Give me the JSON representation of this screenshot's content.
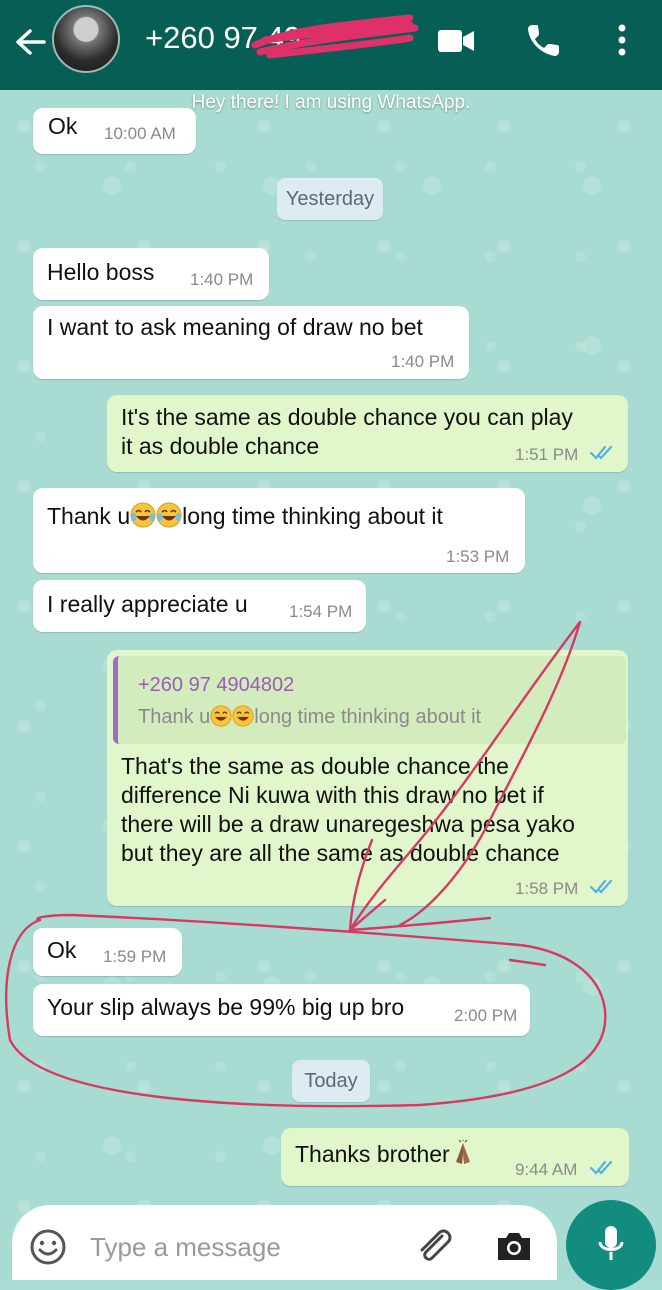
{
  "header": {
    "contact_name": "+260 97 49",
    "status": "Hey there! I am using WhatsApp."
  },
  "icons": {
    "back": "back-arrow-icon",
    "video": "video-call-icon",
    "call": "phone-icon",
    "menu": "more-vert-icon",
    "emoji": "emoji-icon",
    "attach": "paperclip-icon",
    "camera": "camera-icon",
    "mic": "microphone-icon"
  },
  "colors": {
    "header": "#075e54",
    "incoming_bubble": "#ffffff",
    "outgoing_bubble": "#e1f7cb",
    "read_ticks": "#4fb3e6",
    "mic_button": "#128c7e",
    "annotation": "#d63a63"
  },
  "messages": [
    {
      "id": "m0",
      "direction": "in",
      "text": "Ok",
      "time": "10:00 AM"
    },
    {
      "id": "m1",
      "direction": "in",
      "text": "Hello boss",
      "time": "1:40 PM"
    },
    {
      "id": "m2",
      "direction": "in",
      "text": "I want to ask meaning of draw no bet",
      "time": "1:40 PM"
    },
    {
      "id": "m3",
      "direction": "out",
      "line1": "It's the same as double chance you can play",
      "line2": "it as double chance",
      "time": "1:51 PM",
      "read": true
    },
    {
      "id": "m4",
      "direction": "in",
      "text_before": "Thank u",
      "text_after": "long time thinking about it",
      "time": "1:53 PM"
    },
    {
      "id": "m5",
      "direction": "in",
      "text": "I really appreciate u",
      "time": "1:54 PM"
    },
    {
      "id": "m6",
      "direction": "out",
      "quote_author": "+260 97 4904802",
      "quote_before": "Thank u",
      "quote_after": "long time thinking about it",
      "line1": "That's the same as double chance the",
      "line2": "difference Ni kuwa with this draw no bet if",
      "line3": "there will be a draw unaregeshwa pesa yako",
      "line4": "but they are all the same as double chance",
      "time": "1:58 PM",
      "read": true
    },
    {
      "id": "m7",
      "direction": "in",
      "text": "Ok",
      "time": "1:59 PM"
    },
    {
      "id": "m8",
      "direction": "in",
      "text": "Your slip always be 99% big up bro",
      "time": "2:00 PM"
    },
    {
      "id": "m9",
      "direction": "out",
      "text": "Thanks brother",
      "time": "9:44 AM",
      "read": true
    }
  ],
  "date_separators": {
    "yesterday": "Yesterday",
    "today": "Today"
  },
  "composer": {
    "placeholder": "Type a message"
  }
}
